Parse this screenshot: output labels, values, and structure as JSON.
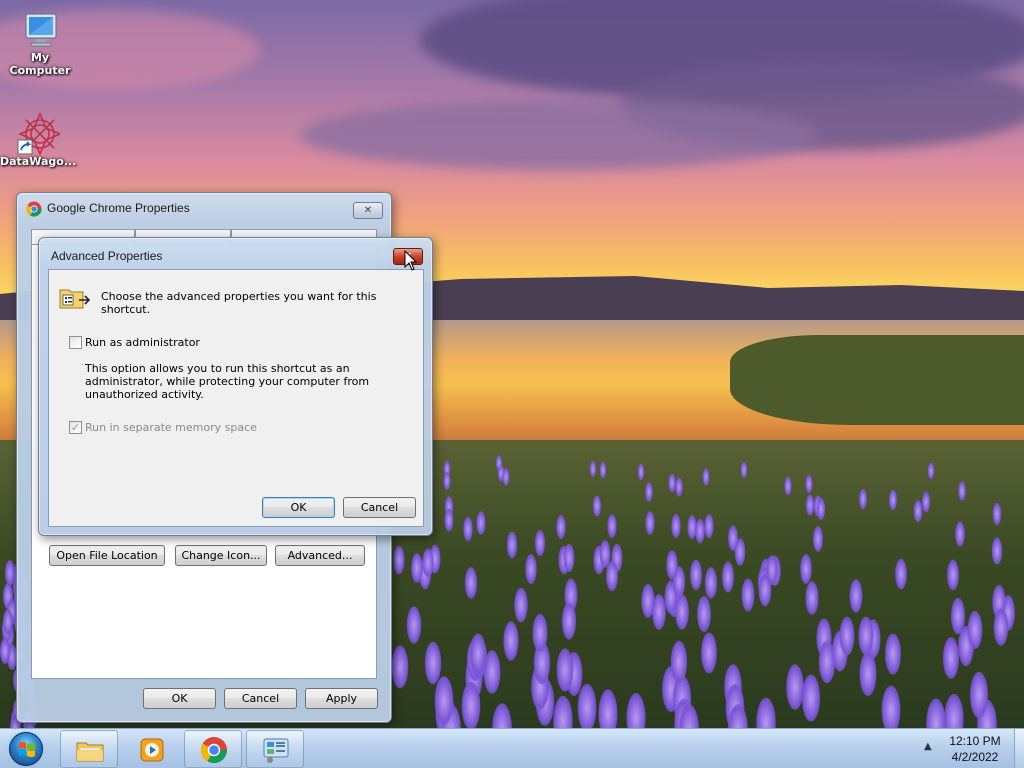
{
  "desktop": {
    "icons": [
      {
        "label": "My\nComputer",
        "icon": "computer-icon"
      },
      {
        "label": "DataWago...",
        "icon": "datawagon-shortcut-icon"
      }
    ]
  },
  "chrome_properties": {
    "title": "Google Chrome Properties",
    "close_label": "✕",
    "buttons": {
      "open_file_location": "Open File Location",
      "change_icon": "Change Icon...",
      "advanced": "Advanced..."
    },
    "footer": {
      "ok": "OK",
      "cancel": "Cancel",
      "apply": "Apply"
    }
  },
  "advanced_properties": {
    "title": "Advanced Properties",
    "close_label": "✕",
    "header_text": "Choose the advanced properties you want for this shortcut.",
    "run_as_admin": {
      "label": "Run as administrator",
      "checked": false
    },
    "description": [
      "This option allows you to run this shortcut as an",
      "administrator, while protecting your computer from",
      "unauthorized activity."
    ],
    "separate_memory": {
      "label": "Run in separate memory space",
      "checked": true,
      "enabled": false
    },
    "ok": "OK",
    "cancel": "Cancel"
  },
  "taskbar": {
    "items": [
      "windows-explorer-icon",
      "media-player-icon",
      "chrome-icon",
      "control-panel-icon"
    ],
    "tray_arrow": "▲",
    "clock": {
      "time": "12:10 PM",
      "date": "4/2/2022"
    }
  }
}
